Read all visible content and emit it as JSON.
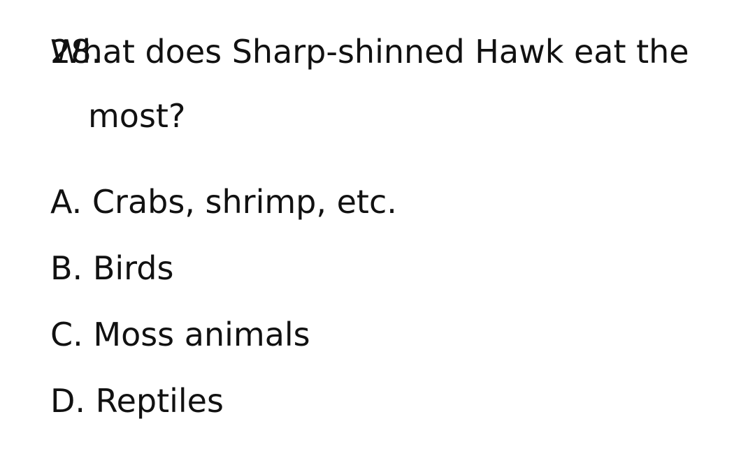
{
  "question": {
    "number": "28.",
    "text": "What does Sharp-shinned Hawk eat the most?"
  },
  "options": [
    {
      "letter": "A.",
      "text": "Crabs, shrimp, etc."
    },
    {
      "letter": "B.",
      "text": "Birds"
    },
    {
      "letter": "C.",
      "text": "Moss animals"
    },
    {
      "letter": "D.",
      "text": "Reptiles"
    }
  ]
}
